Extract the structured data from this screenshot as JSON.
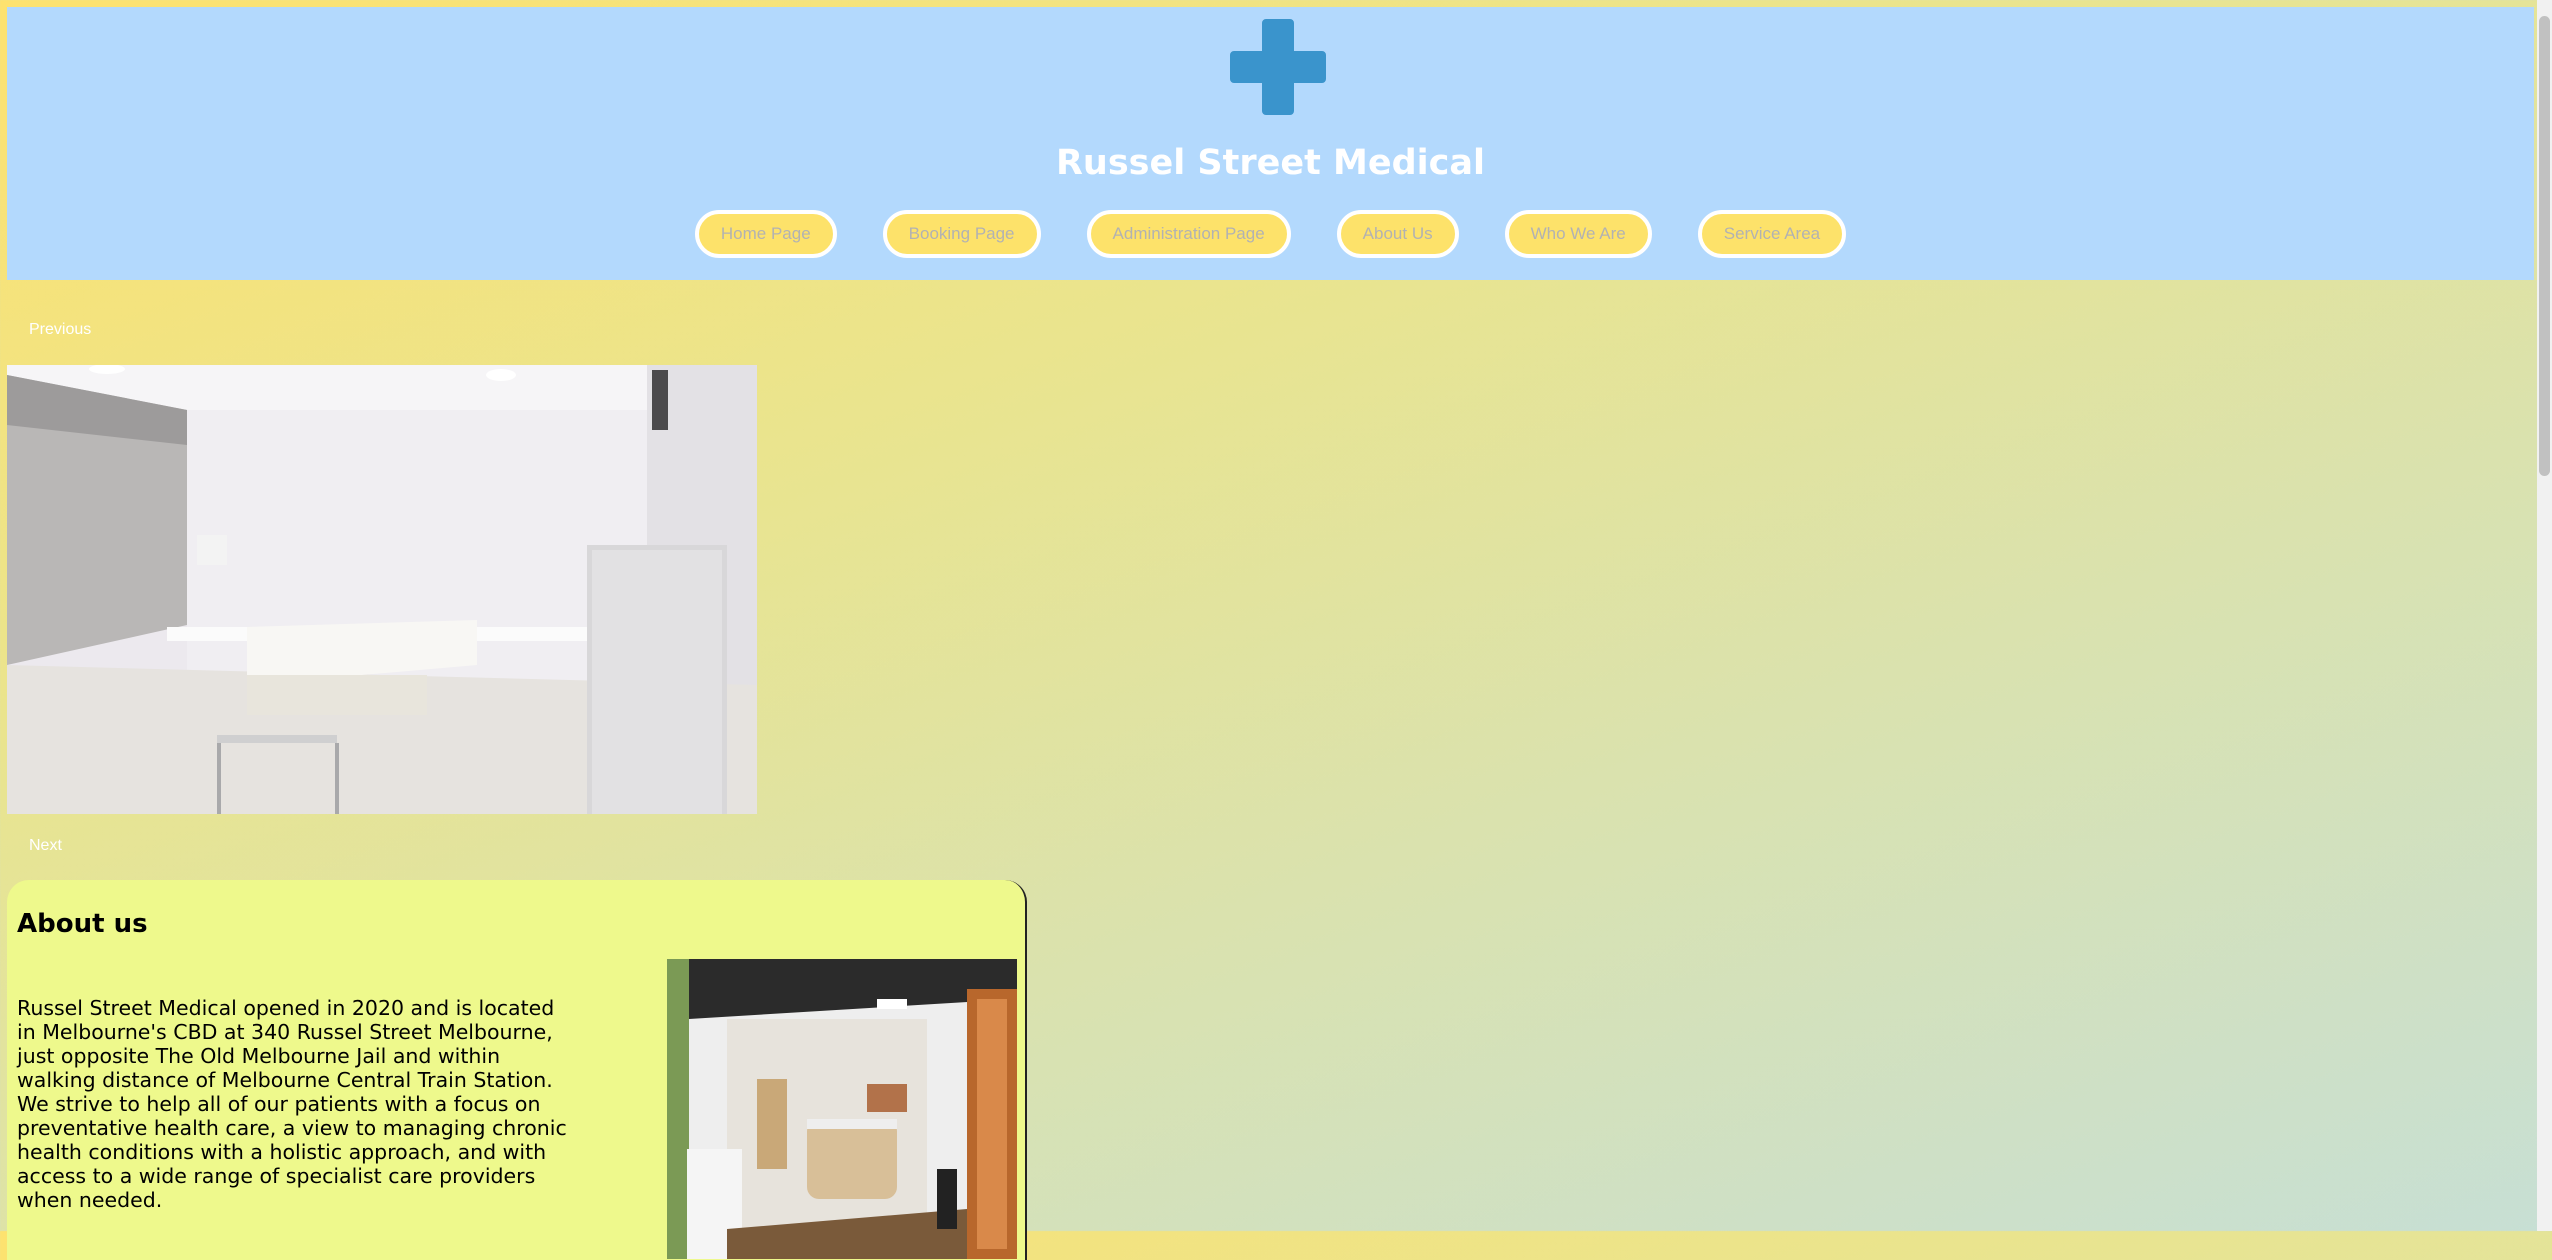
{
  "header": {
    "title": "Russel Street Medical",
    "logo_icon": "medical-cross-icon",
    "logo_color": "#3a94cc",
    "background": "#b3d9fd"
  },
  "nav": {
    "items": [
      {
        "label": "Home Page"
      },
      {
        "label": "Booking Page"
      },
      {
        "label": "Administration Page"
      },
      {
        "label": "About Us"
      },
      {
        "label": "Who We Are"
      },
      {
        "label": "Service Area"
      }
    ]
  },
  "slideshow": {
    "previous_label": "Previous",
    "next_label": "Next"
  },
  "about": {
    "heading": "About us",
    "body": "Russel Street Medical opened in 2020 and is located in Melbourne's CBD at 340 Russel Street Melbourne, just opposite The Old Melbourne Jail and within walking distance of Melbourne Central Train Station. We strive to help all of our patients with a focus on preventative health care, a view to managing chronic health conditions with a holistic approach, and with access to a wide range of specialist care providers when needed."
  }
}
